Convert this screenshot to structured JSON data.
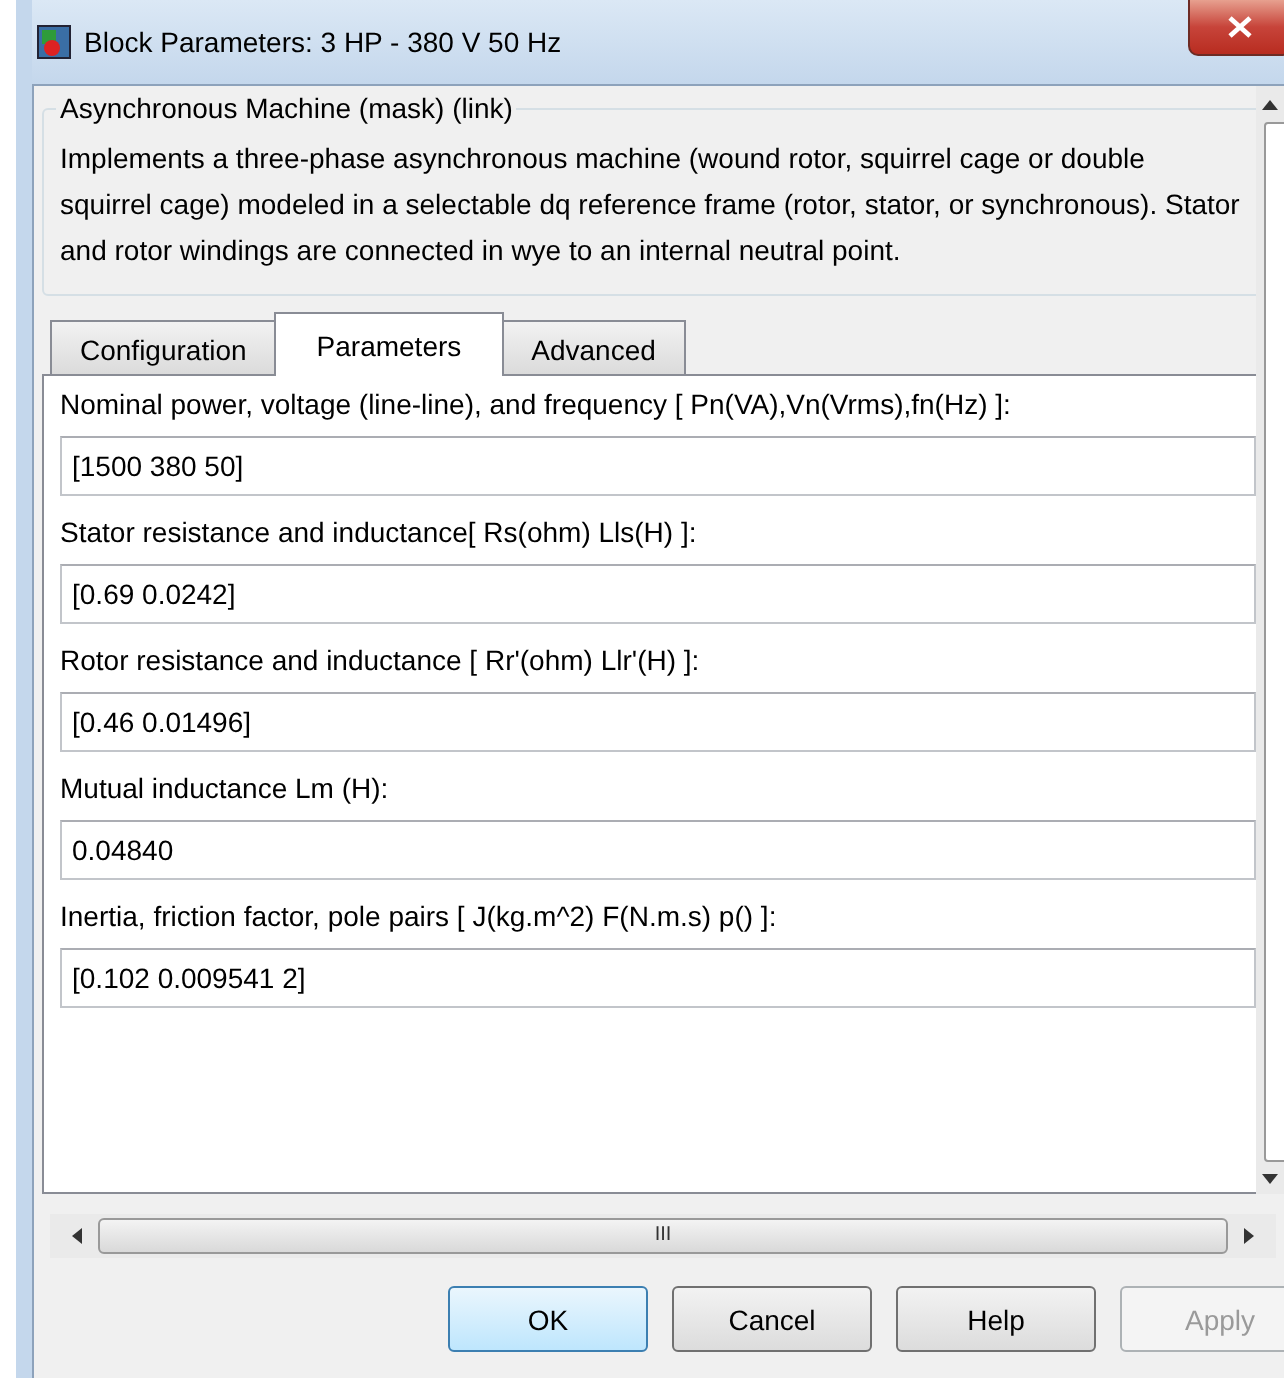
{
  "window": {
    "title": "Block Parameters: 3 HP - 380 V 50 Hz"
  },
  "group": {
    "title": "Asynchronous Machine (mask) (link)",
    "description": "Implements a three-phase asynchronous machine (wound rotor, squirrel cage or double squirrel cage) modeled in a selectable dq reference frame (rotor, stator, or synchronous). Stator and rotor windings are connected in wye to an internal neutral point."
  },
  "tabs": [
    {
      "label": "Configuration",
      "selected": false
    },
    {
      "label": "Parameters",
      "selected": true
    },
    {
      "label": "Advanced",
      "selected": false
    }
  ],
  "parameters": [
    {
      "label": "Nominal power, voltage (line-line), and frequency [ Pn(VA),Vn(Vrms),fn(Hz) ]:",
      "value": "[1500 380 50]"
    },
    {
      "label": "Stator resistance and inductance[ Rs(ohm)  Lls(H) ]:",
      "value": "[0.69 0.0242]"
    },
    {
      "label": "Rotor resistance and inductance [ Rr'(ohm)  Llr'(H) ]:",
      "value": "[0.46 0.01496]"
    },
    {
      "label": "Mutual inductance Lm (H):",
      "value": "0.04840"
    },
    {
      "label": "Inertia, friction factor, pole pairs [ J(kg.m^2)  F(N.m.s)   p() ]:",
      "value": "[0.102 0.009541 2]"
    }
  ],
  "horizontal_scrollbar": {
    "thumb_label": "III"
  },
  "buttons": [
    {
      "label": "OK",
      "default": true,
      "disabled": false
    },
    {
      "label": "Cancel",
      "default": false,
      "disabled": false
    },
    {
      "label": "Help",
      "default": false,
      "disabled": false
    },
    {
      "label": "Apply",
      "default": false,
      "disabled": true
    }
  ]
}
